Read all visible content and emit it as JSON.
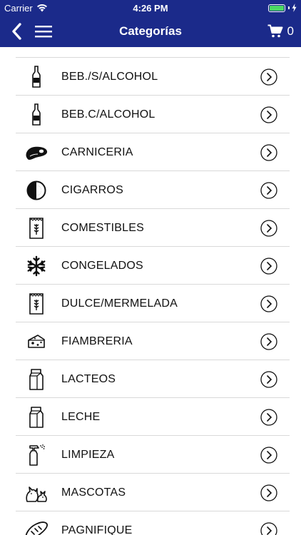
{
  "status": {
    "carrier": "Carrier",
    "time": "4:26 PM"
  },
  "nav": {
    "title": "Categorías",
    "cart_count": "0"
  },
  "categories": [
    {
      "label": "BEB./S/ALCOHOL",
      "icon": "bottle-icon"
    },
    {
      "label": "BEB.C/ALCOHOL",
      "icon": "bottle-icon"
    },
    {
      "label": "CARNICERIA",
      "icon": "steak-icon"
    },
    {
      "label": "CIGARROS",
      "icon": "half-circle-icon"
    },
    {
      "label": "COMESTIBLES",
      "icon": "grain-bag-icon"
    },
    {
      "label": "CONGELADOS",
      "icon": "snowflake-icon"
    },
    {
      "label": "DULCE/MERMELADA",
      "icon": "grain-bag-icon"
    },
    {
      "label": "FIAMBRERIA",
      "icon": "cheese-icon"
    },
    {
      "label": "LACTEOS",
      "icon": "milk-carton-icon"
    },
    {
      "label": "LECHE",
      "icon": "milk-carton-icon"
    },
    {
      "label": "LIMPIEZA",
      "icon": "spray-bottle-icon"
    },
    {
      "label": "MASCOTAS",
      "icon": "pets-icon"
    },
    {
      "label": "PAGNIFIQUE",
      "icon": "bread-icon"
    }
  ],
  "colors": {
    "header": "#1b2a8a",
    "battery": "#4cd964",
    "divider": "#d9d9d9"
  }
}
